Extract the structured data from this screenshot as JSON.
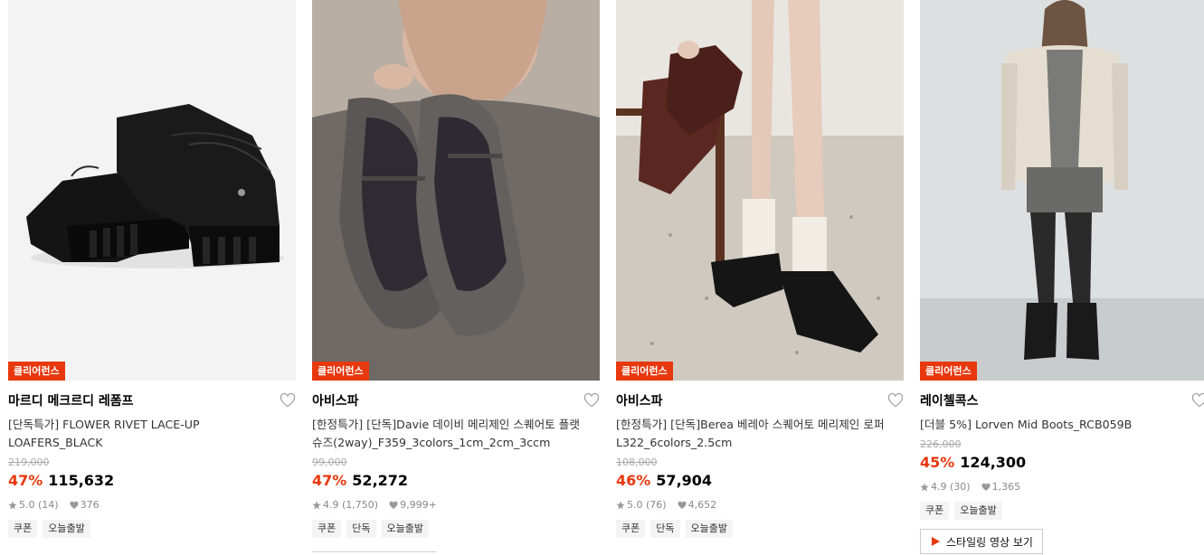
{
  "products": [
    {
      "badge": "클리어런스",
      "brand": "마르디 메크르디 레폼프",
      "title": "[단독특가] FLOWER RIVET LACE-UP LOAFERS_BLACK",
      "original_price": "219,000",
      "discount": "47%",
      "price": "115,632",
      "rating": "5.0",
      "reviews": "(14)",
      "likes": "376",
      "tags": [
        "쿠폰",
        "오늘출발"
      ]
    },
    {
      "badge": "클리어런스",
      "brand": "아비스파",
      "title": "[한정특가] [단독]Davie 데이비 메리제인 스퀘어토 플랫슈즈(2way)_F359_3colors_1cm_2cm_3ccm",
      "original_price": "99,000",
      "discount": "47%",
      "price": "52,272",
      "rating": "4.9",
      "reviews": "(1,750)",
      "likes": "9,999+",
      "tags": [
        "쿠폰",
        "단독",
        "오늘출발"
      ]
    },
    {
      "badge": "클리어런스",
      "brand": "아비스파",
      "title": "[한정특가] [단독]Berea 베레아 스퀘어토 메리제인 로퍼 L322_6colors_2.5cm",
      "original_price": "108,000",
      "discount": "46%",
      "price": "57,904",
      "rating": "5.0",
      "reviews": "(76)",
      "likes": "4,652",
      "tags": [
        "쿠폰",
        "단독",
        "오늘출발"
      ]
    },
    {
      "badge": "클리어런스",
      "brand": "레이첼콕스",
      "title": "[더블 5%] Lorven Mid Boots_RCB059B",
      "original_price": "226,000",
      "discount": "45%",
      "price": "124,300",
      "rating": "4.9",
      "reviews": "(30)",
      "likes": "1,365",
      "tags": [
        "쿠폰",
        "오늘출발"
      ],
      "video_button": "스타일링 영상 보기"
    }
  ],
  "colors": {
    "accent": "#e8380d",
    "tag_bg": "#f4f4f4"
  },
  "icons": {
    "heart": "heart-outline-icon",
    "star": "star-icon",
    "like": "heart-filled-icon",
    "play": "play-icon"
  }
}
